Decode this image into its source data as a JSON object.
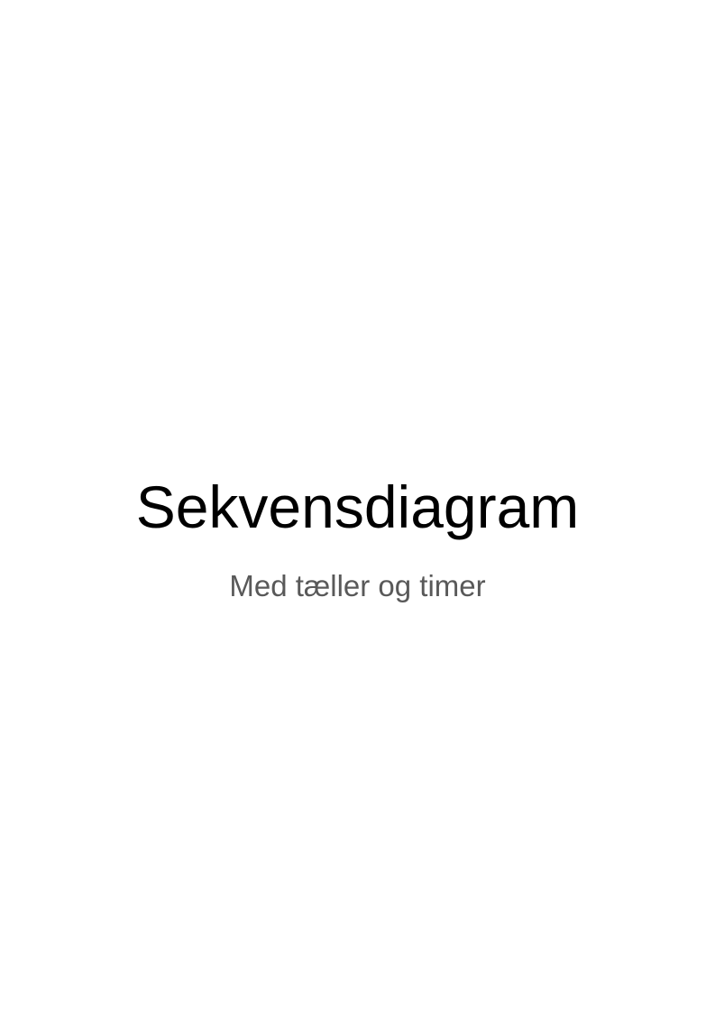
{
  "slide": {
    "title": "Sekvensdiagram",
    "subtitle": "Med tæller og timer"
  },
  "colors": {
    "background": "#ffffff",
    "title": "#000000",
    "subtitle": "#595959"
  }
}
